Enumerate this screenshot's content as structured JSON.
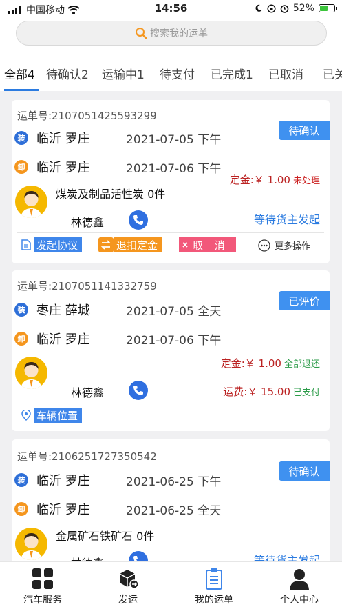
{
  "status_bar": {
    "carrier": "中国移动",
    "time": "14:56",
    "battery": "52%",
    "battery_level": 0.52
  },
  "search": {
    "placeholder": "搜索我的运单"
  },
  "tabs": [
    {
      "label": "全部4"
    },
    {
      "label": "待确认2"
    },
    {
      "label": "运输中1"
    },
    {
      "label": "待支付"
    },
    {
      "label": "已完成1"
    },
    {
      "label": "已取消"
    },
    {
      "label": "已关"
    }
  ],
  "orders": [
    {
      "order_no": "运单号:2107051425593299",
      "status": "待确认",
      "load_mark": "装",
      "unload_mark": "卸",
      "load_place": "临沂 罗庄",
      "load_date": "2021-07-05 下午",
      "unload_place": "临沂 罗庄",
      "unload_date": "2021-07-06 下午",
      "deposit_label": "定金:￥ 1.00",
      "deposit_state": "未处理",
      "goods": "煤炭及制品活性炭  0件",
      "driver": "林德鑫",
      "waiting": "等待货主发起",
      "actions": {
        "agreement": "发起协议",
        "refund": "退扣定金",
        "cancel": "取 消",
        "more": "更多操作"
      }
    },
    {
      "order_no": "运单号:2107051141332759",
      "status": "已评价",
      "load_mark": "装",
      "unload_mark": "卸",
      "load_place": "枣庄 薛城",
      "load_date": "2021-07-05 全天",
      "unload_place": "临沂 罗庄",
      "unload_date": "2021-07-06 下午",
      "deposit_label": "定金:￥ 1.00",
      "deposit_state": "全部退还",
      "freight_label": "运费:￥ 15.00",
      "freight_state": "已支付",
      "driver": "林德鑫",
      "actions": {
        "vehicle_location": "车辆位置"
      }
    },
    {
      "order_no": "运单号:2106251727350542",
      "status": "待确认",
      "load_mark": "装",
      "unload_mark": "卸",
      "load_place": "临沂 罗庄",
      "load_date": "2021-06-25 下午",
      "unload_place": "临沂 罗庄",
      "unload_date": "2021-06-25 全天",
      "goods": "金属矿石铁矿石  0件",
      "driver": "林德鑫",
      "waiting": "等待货主发起"
    }
  ],
  "bottom_nav": [
    {
      "label": "汽车服务",
      "icon": "grid-icon"
    },
    {
      "label": "发运",
      "icon": "box-icon"
    },
    {
      "label": "我的运单",
      "icon": "clipboard-icon"
    },
    {
      "label": "个人中心",
      "icon": "person-icon"
    }
  ],
  "colors": {
    "accent": "#3f91f0",
    "orange": "#f5961e",
    "pink": "#f2587a",
    "deposit_red": "#b22222",
    "paid_green": "#2b9b48"
  }
}
